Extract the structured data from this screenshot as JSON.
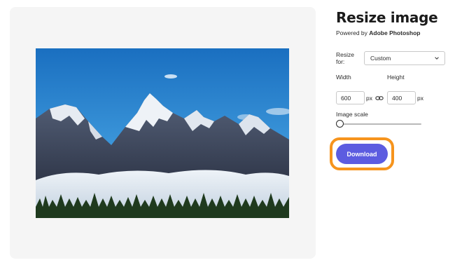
{
  "header": {
    "title": "Resize image",
    "powered_prefix": "Powered by",
    "powered_brand": "Adobe Photoshop"
  },
  "resize": {
    "label": "Resize for:",
    "selected": "Custom"
  },
  "dimensions": {
    "width_label": "Width",
    "width_value": "600",
    "height_label": "Height",
    "height_value": "400",
    "unit": "px"
  },
  "scale": {
    "label": "Image scale",
    "level": 0
  },
  "actions": {
    "download_label": "Download"
  },
  "colors": {
    "accent": "#5c5ce0",
    "highlight": "#f6941d",
    "canvas": "#f5f5f5"
  }
}
